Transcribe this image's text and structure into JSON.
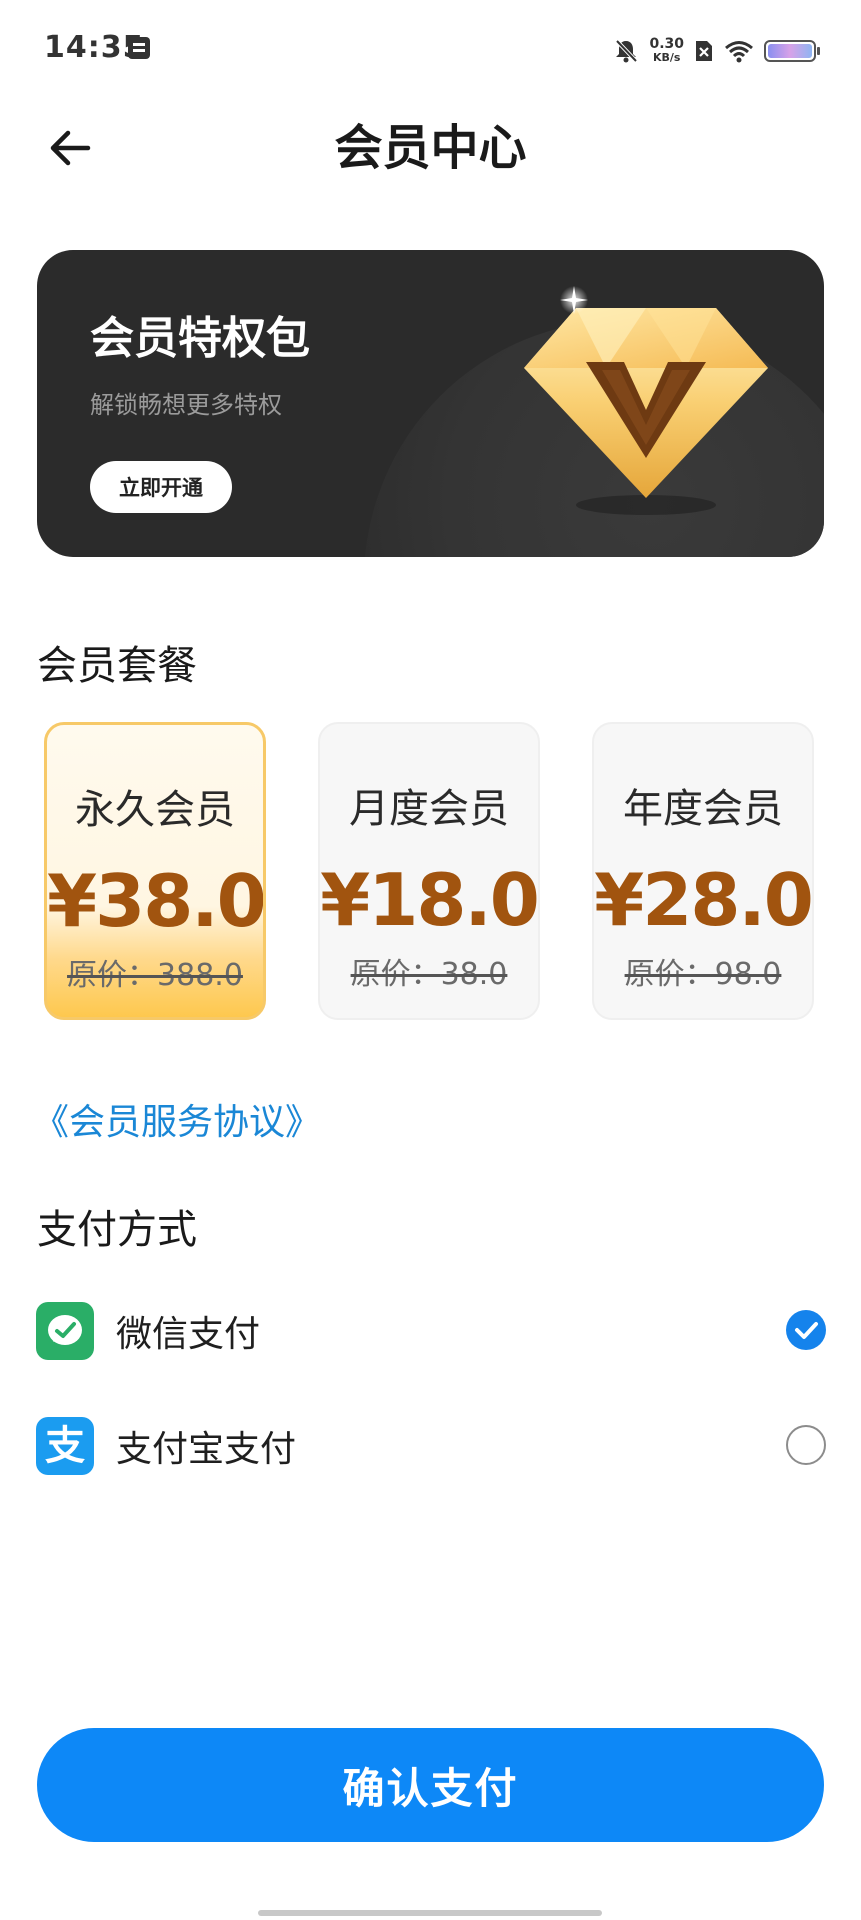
{
  "status_bar": {
    "time": "14:35",
    "net_speed_value": "0.30",
    "net_speed_unit": "KB/s",
    "icons": [
      "note-icon",
      "mute-icon",
      "sim-off-icon",
      "wifi-icon",
      "battery-icon"
    ]
  },
  "header": {
    "title": "会员中心",
    "back_icon": "back-arrow-icon"
  },
  "banner": {
    "title": "会员特权包",
    "subtitle": "解锁畅想更多特权",
    "button_label": "立即开通",
    "icon": "vip-diamond-icon"
  },
  "plans": {
    "section_title": "会员套餐",
    "items": [
      {
        "name": "永久会员",
        "price": "¥38.0",
        "original": "原价：388.0",
        "selected": true
      },
      {
        "name": "月度会员",
        "price": "¥18.0",
        "original": "原价：38.0",
        "selected": false
      },
      {
        "name": "年度会员",
        "price": "¥28.0",
        "original": "原价：98.0",
        "selected": false
      }
    ]
  },
  "agreement_link": "《会员服务协议》",
  "payment": {
    "section_title": "支付方式",
    "methods": [
      {
        "label": "微信支付",
        "icon": "wechat-pay-icon",
        "checked": true
      },
      {
        "label": "支付宝支付",
        "icon": "alipay-icon",
        "checked": false
      }
    ]
  },
  "confirm_button": "确认支付",
  "colors": {
    "accent_blue": "#0d88f7",
    "price_brown": "#a1540f",
    "selected_gold": "#fec84e",
    "wechat_green": "#2aae67",
    "alipay_blue": "#1b9cf0"
  }
}
